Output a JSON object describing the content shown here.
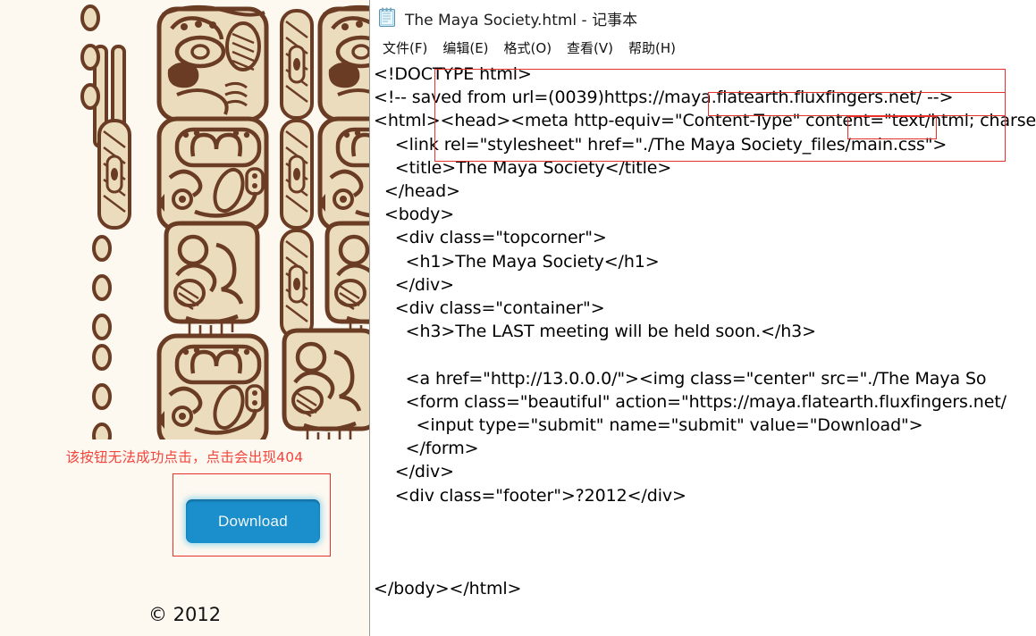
{
  "webpage": {
    "background_color": "#fdf8f0",
    "glyph_image_alt": "maya-glyph-grid",
    "warning_text": "该按钮无法成功点击，点击会出现404",
    "warning_color": "#f2453d",
    "download_button_label": "Download",
    "download_button_color": "#1a8fcc",
    "annotation_box_color": "#e8312a",
    "footer_text": "© 2012"
  },
  "notepad": {
    "icon": "notepad-icon",
    "title": "The Maya Society.html - 记事本",
    "menu": [
      {
        "label": "文件(F)"
      },
      {
        "label": "编辑(E)"
      },
      {
        "label": "格式(O)"
      },
      {
        "label": "查看(V)"
      },
      {
        "label": "帮助(H)"
      }
    ],
    "source_code": "<!DOCTYPE html>\n<!-- saved from url=(0039)https://maya.flatearth.fluxfingers.net/ -->\n<html><head><meta http-equiv=\"Content-Type\" content=\"text/html; charse\n    <link rel=\"stylesheet\" href=\"./The Maya Society_files/main.css\">\n    <title>The Maya Society</title>\n  </head>\n  <body>\n    <div class=\"topcorner\">\n      <h1>The Maya Society</h1>\n    </div>\n    <div class=\"container\">\n      <h3>The LAST meeting will be held soon.</h3>\n\n      <a href=\"http://13.0.0.0/\"><img class=\"center\" src=\"./The Maya So\n      <form class=\"beautiful\" action=\"https://maya.flatearth.fluxfingers.net/\n        <input type=\"submit\" name=\"submit\" value=\"Download\">\n      </form>\n    </div>\n    <div class=\"footer\">?2012</div>\n\n\n\n</body></html>",
    "highlight_boxes": [
      {
        "name": "form-block",
        "color": "#e8312a"
      },
      {
        "name": "action-url",
        "color": "#e8312a"
      },
      {
        "name": "download-value",
        "color": "#e8312a"
      }
    ]
  }
}
